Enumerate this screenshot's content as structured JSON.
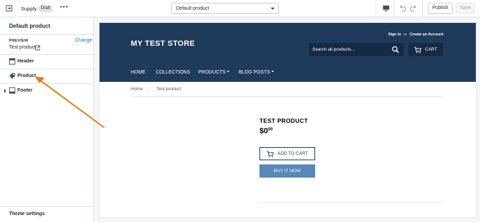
{
  "topbar": {
    "theme_name": "Supply",
    "status_badge": "Draft",
    "more_label": "•••",
    "template_select": "Default product",
    "publish_label": "Publish",
    "save_label": "Save"
  },
  "sidebar": {
    "title": "Default product",
    "preview_label": "PREVIEW",
    "change_label": "Change",
    "preview_product": "Test product",
    "sections": [
      {
        "label": "Header",
        "icon": "header-section-icon"
      },
      {
        "label": "Product",
        "icon": "tag-icon"
      },
      {
        "label": "Footer",
        "icon": "footer-section-icon"
      }
    ],
    "theme_settings_label": "Theme settings"
  },
  "store": {
    "logo": "MY TEST STORE",
    "sign_in": "Sign in",
    "or": "or",
    "create_account": "Create an Account",
    "search_placeholder": "Search all products...",
    "cart_label": "CART",
    "nav": [
      "HOME",
      "COLLECTIONS",
      "PRODUCTS",
      "BLOG POSTS"
    ],
    "breadcrumb": {
      "home": "Home",
      "separator": "›",
      "current": "Test product"
    },
    "product_title": "TEST PRODUCT",
    "price_main": "$0",
    "price_cents": "00",
    "add_to_cart_label": "ADD TO CART",
    "buy_now_label": "BUY IT NOW"
  },
  "colors": {
    "header_bg": "#203a5c",
    "search_bg": "#152a45",
    "buy_now": "#5887b8",
    "link": "#007ace",
    "annotation_arrow": "#e07b1f"
  }
}
